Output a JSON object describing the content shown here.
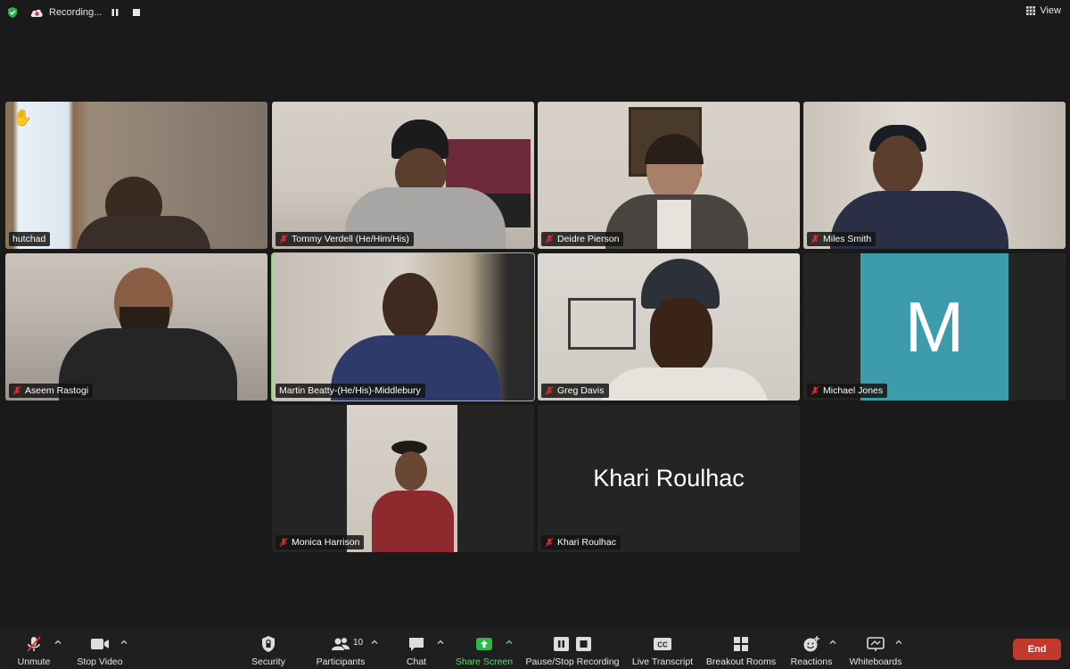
{
  "top": {
    "recording_label": "Recording...",
    "view_label": "View"
  },
  "tiles": [
    {
      "name": "hutchad",
      "muted": false,
      "raised_hand": true
    },
    {
      "name": "Tommy Verdell (He/Him/His)",
      "muted": true
    },
    {
      "name": "Deidre Pierson",
      "muted": true
    },
    {
      "name": "Miles Smith",
      "muted": true
    },
    {
      "name": "Aseem Rastogi",
      "muted": true
    },
    {
      "name": "Martin Beatty-(He/His)-Middlebury",
      "muted": true,
      "active_speaker": true
    },
    {
      "name": "Greg Davis",
      "muted": true
    },
    {
      "name": "Michael Jones",
      "muted": true,
      "avatar_letter": "M",
      "avatar_color": "#3c9cab"
    },
    {
      "name": "Monica Harrison",
      "muted": true
    },
    {
      "name": "Khari Roulhac",
      "muted": true,
      "camera_off_name": "Khari Roulhac"
    }
  ],
  "toolbar": {
    "unmute": "Unmute",
    "stop_video": "Stop Video",
    "security": "Security",
    "participants": "Participants",
    "participants_count": "10",
    "chat": "Chat",
    "share_screen": "Share Screen",
    "pause_stop_recording": "Pause/Stop Recording",
    "live_transcript": "Live Transcript",
    "live_transcript_icon_text": "CC",
    "breakout_rooms": "Breakout Rooms",
    "reactions": "Reactions",
    "whiteboards": "Whiteboards",
    "end": "End"
  },
  "colors": {
    "active_border": "#7fd36b",
    "share_green": "#6bd36b",
    "end_red": "#c0392b",
    "muted_red": "#e02f2f"
  }
}
